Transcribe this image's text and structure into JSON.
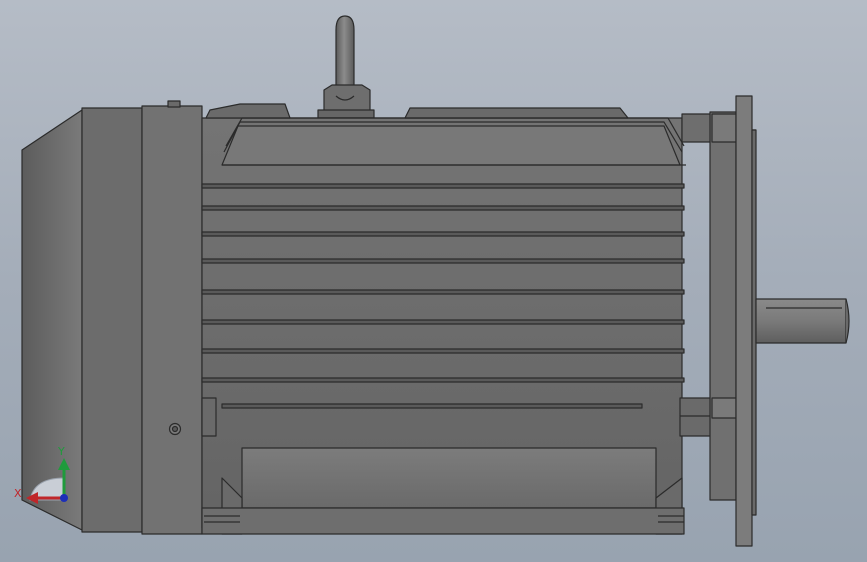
{
  "viewport": {
    "background_top": "#b5bcc6",
    "background_bottom": "#98a3b0"
  },
  "model": {
    "body_color": "#6e6e6e",
    "edge_color": "#2b2b2b",
    "fin_count": 9
  },
  "triad": {
    "x_label": "X",
    "y_label": "Y",
    "x_color": "#c0262a",
    "y_color": "#1f9b3c",
    "z_color": "#1d2fb8"
  }
}
